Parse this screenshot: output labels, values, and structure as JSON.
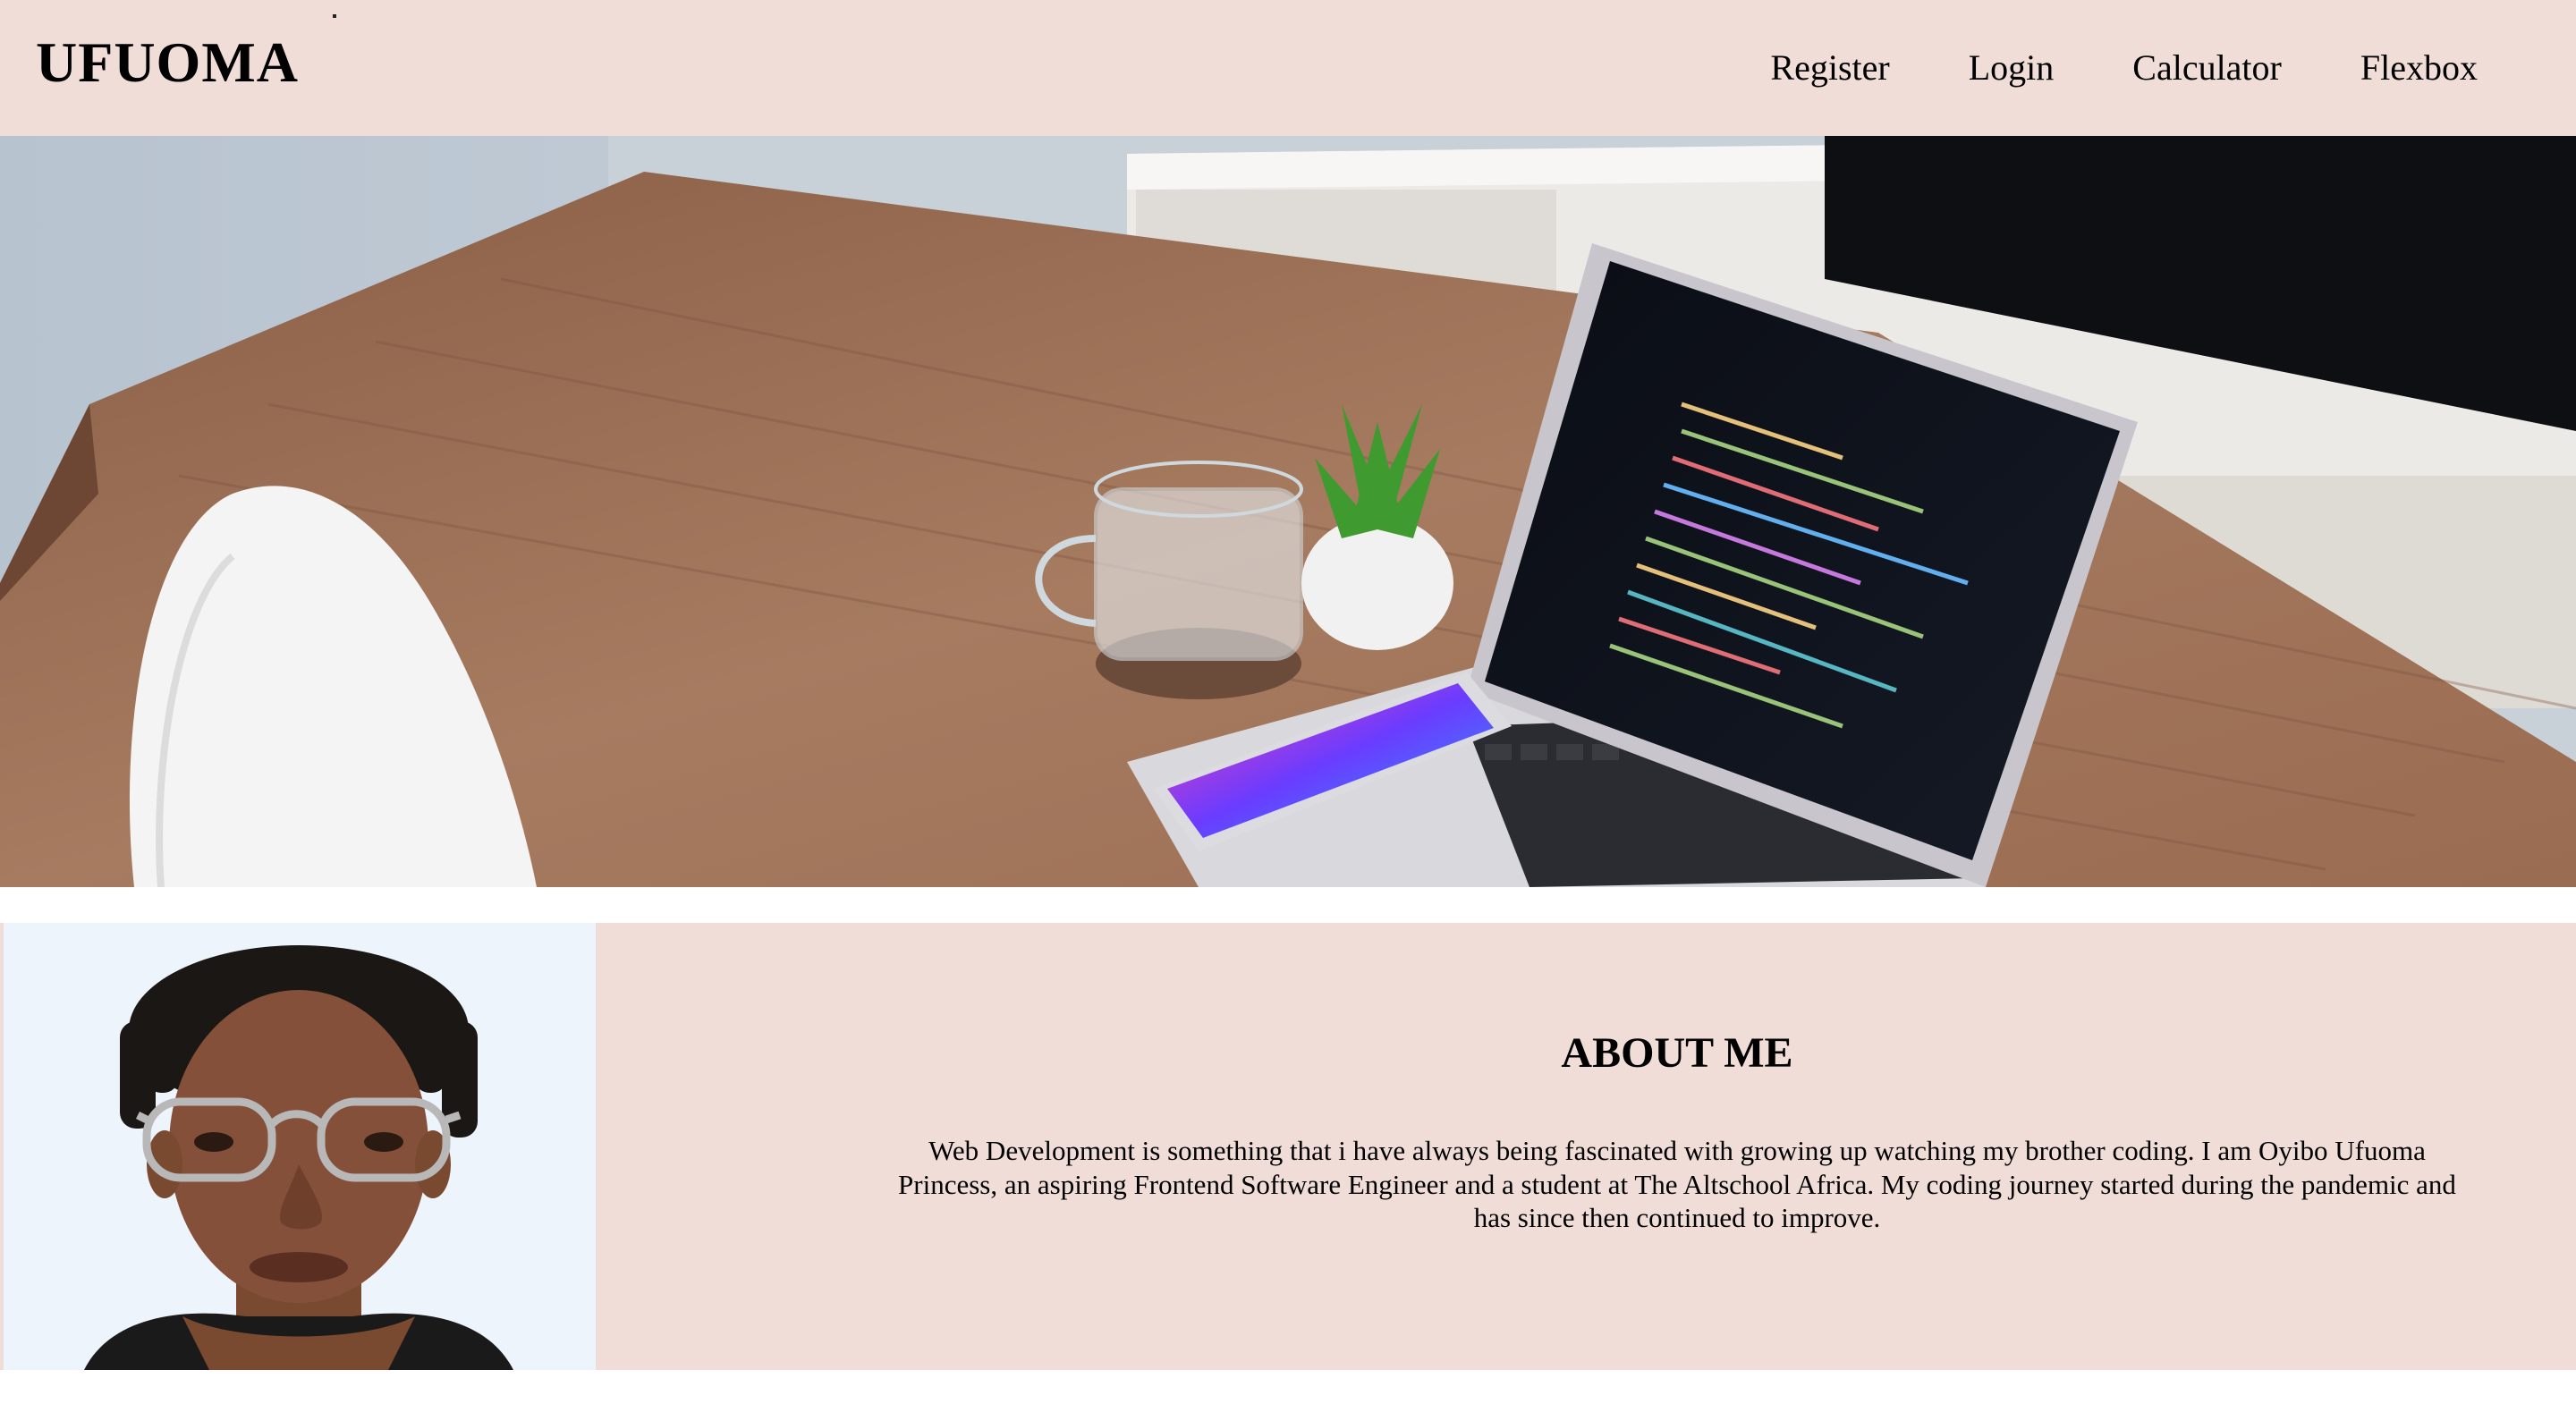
{
  "brand": {
    "name": "UFUOMA"
  },
  "nav": {
    "items": [
      {
        "label": "Register"
      },
      {
        "label": "Login"
      },
      {
        "label": "Calculator"
      },
      {
        "label": "Flexbox"
      }
    ]
  },
  "hero": {
    "icon": "desk-laptop-photo"
  },
  "about": {
    "title": "ABOUT ME",
    "body": "Web Development is something that i have always being fascinated with growing up watching my brother coding. I am Oyibo Ufuoma Princess, an aspiring Frontend Software Engineer and a student at The Altschool Africa. My coding journey started during the pandemic and has since then continued to improve.",
    "photo_icon": "profile-portrait-photo"
  },
  "colors": {
    "header_bg": "#f1ddd7",
    "about_bg": "#f1ddd7",
    "photo_bg": "#eef4fb"
  }
}
